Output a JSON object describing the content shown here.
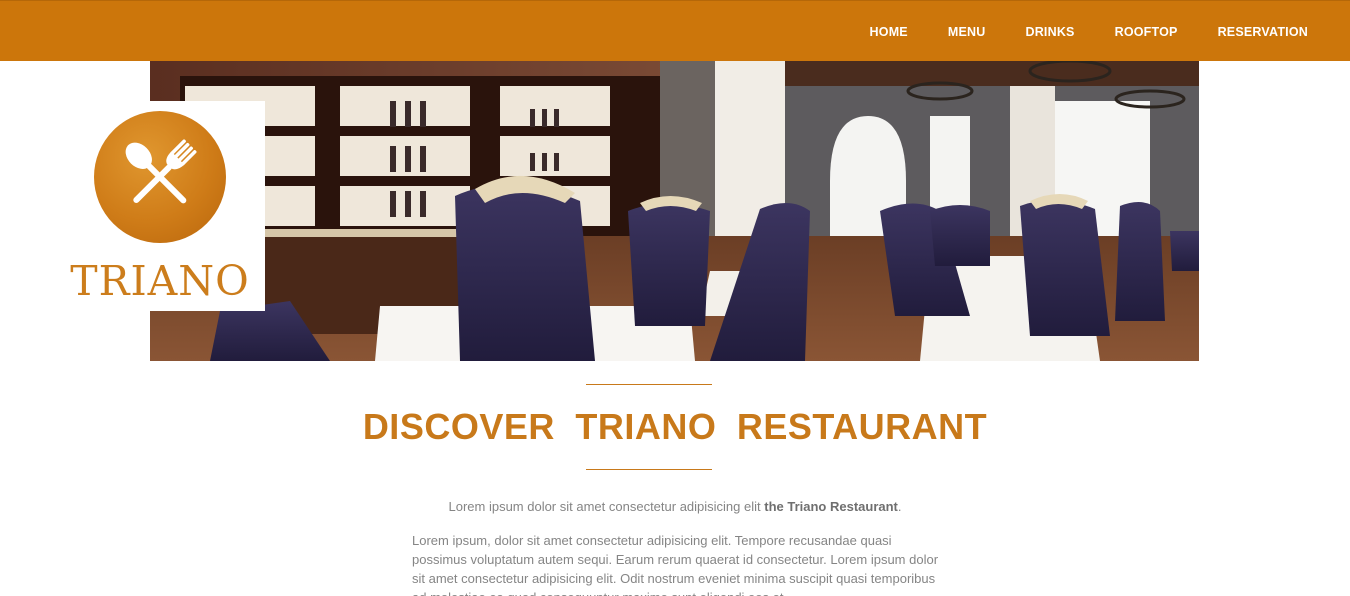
{
  "nav": {
    "items": [
      "HOME",
      "MENU",
      "DRINKS",
      "ROOFTOP",
      "RESERVATION"
    ]
  },
  "brand": {
    "name": "TRIANO",
    "logo_icon": "fork-spoon-crossed-icon",
    "color": "#cc760b"
  },
  "hero": {
    "image": "restaurant-interior-photo"
  },
  "section": {
    "title": "DISCOVER TRIANO RESTAURANT",
    "intro_prefix": "Lorem ipsum dolor sit amet consectetur adipisicing elit ",
    "intro_bold": "the Triano Restaurant",
    "intro_suffix": ".",
    "body": "Lorem ipsum, dolor sit amet consectetur adipisicing elit. Tempore recusandae quasi possimus voluptatum autem sequi. Earum rerum quaerat id consectetur. Lorem ipsum dolor sit amet consectetur adipisicing elit. Odit nostrum eveniet minima suscipit quasi temporibus ad molestiae ea quod consequuntur maxime sunt eligendi eos et"
  },
  "colors": {
    "accent": "#cc760b",
    "text": "#858585"
  }
}
